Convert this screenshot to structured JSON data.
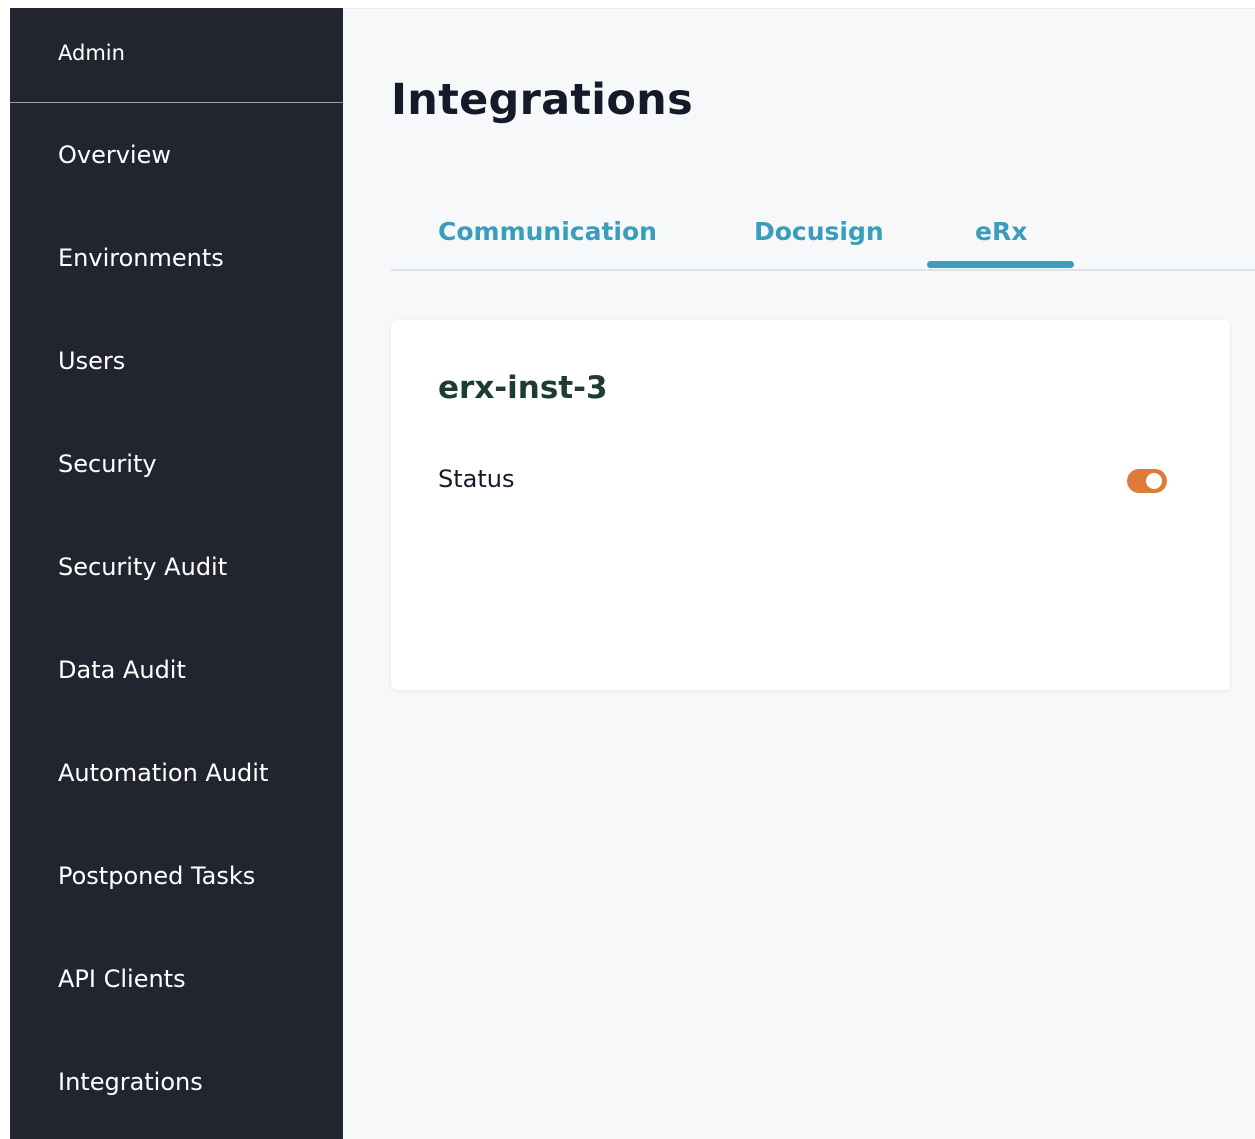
{
  "sidebar": {
    "header": "Admin",
    "items": [
      {
        "label": "Overview"
      },
      {
        "label": "Environments"
      },
      {
        "label": "Users"
      },
      {
        "label": "Security"
      },
      {
        "label": "Security Audit"
      },
      {
        "label": "Data Audit"
      },
      {
        "label": "Automation Audit"
      },
      {
        "label": "Postponed Tasks"
      },
      {
        "label": "API Clients"
      },
      {
        "label": "Integrations"
      }
    ]
  },
  "main": {
    "title": "Integrations",
    "tabs": [
      {
        "label": "Communication"
      },
      {
        "label": "Docusign"
      },
      {
        "label": "eRx"
      }
    ],
    "active_tab": "eRx",
    "card": {
      "title": "erx-inst-3",
      "status_label": "Status",
      "status_enabled": true
    }
  },
  "colors": {
    "sidebar_bg": "#22252f",
    "accent": "#3a9dbb",
    "toggle_on": "#e07a3a",
    "card_title": "#1e3b34"
  }
}
